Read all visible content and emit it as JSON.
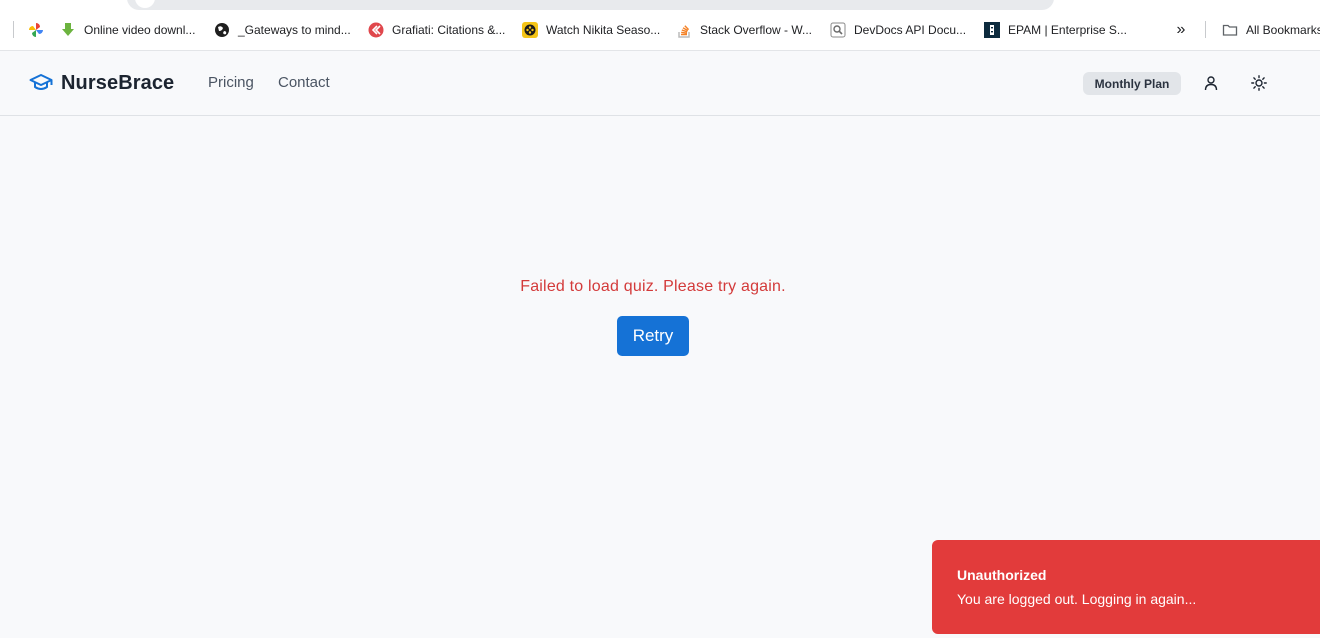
{
  "bookmarks": {
    "items": [
      {
        "label": "Online video downl...",
        "icon": "download-arrow-icon"
      },
      {
        "label": "_Gateways to mind...",
        "icon": "globe-icon"
      },
      {
        "label": "Grafiati: Citations &...",
        "icon": "grafiati-icon"
      },
      {
        "label": "Watch Nikita Seaso...",
        "icon": "film-reel-icon"
      },
      {
        "label": "Stack Overflow - W...",
        "icon": "stackoverflow-icon"
      },
      {
        "label": "DevDocs API Docu...",
        "icon": "devdocs-icon"
      },
      {
        "label": "EPAM | Enterprise S...",
        "icon": "epam-icon"
      }
    ],
    "more_glyph": "»",
    "all_bookmarks": "All Bookmarks"
  },
  "header": {
    "brand": "NurseBrace",
    "nav": [
      "Pricing",
      "Contact"
    ],
    "plan_badge": "Monthly Plan"
  },
  "main": {
    "error_message": "Failed to load quiz. Please try again.",
    "retry_label": "Retry"
  },
  "toast": {
    "title": "Unauthorized",
    "message": "You are logged out. Logging in again..."
  },
  "colors": {
    "brand_blue": "#1572d6",
    "error_red": "#d33a3a",
    "toast_red": "#e23b3b"
  }
}
